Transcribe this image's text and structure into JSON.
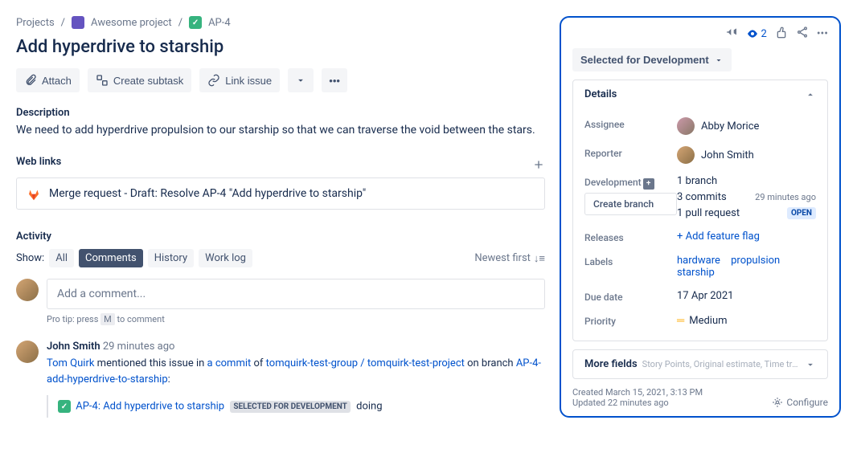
{
  "breadcrumb": {
    "projects": "Projects",
    "project_name": "Awesome project",
    "issue_key": "AP-4"
  },
  "issue": {
    "title": "Add hyperdrive to starship"
  },
  "toolbar": {
    "attach": "Attach",
    "create_subtask": "Create subtask",
    "link_issue": "Link issue"
  },
  "description": {
    "heading": "Description",
    "text": "We need to add hyperdrive propulsion to our starship so that we can traverse the void between the stars."
  },
  "weblinks": {
    "heading": "Web links",
    "item": "Merge request - Draft: Resolve AP-4 \"Add hyperdrive to starship\""
  },
  "activity": {
    "heading": "Activity",
    "show_label": "Show:",
    "tabs": {
      "all": "All",
      "comments": "Comments",
      "history": "History",
      "worklog": "Work log"
    },
    "sort": "Newest first",
    "comment_placeholder": "Add a comment...",
    "protip_pre": "Pro tip: press",
    "protip_key": "M",
    "protip_post": "to comment"
  },
  "comment": {
    "author": "John Smith",
    "time": "29 minutes ago",
    "text_user": "Tom Quirk",
    "text_mid1": " mentioned this issue in ",
    "text_commit": "a commit",
    "text_mid2": " of ",
    "text_project": "tomquirk-test-group / tomquirk-test-project",
    "text_mid3": " on branch ",
    "text_branch": "AP-4-add-hyperdrive-to-starship",
    "ref_key": "AP-4: Add hyperdrive to starship",
    "ref_status": "SELECTED FOR DEVELOPMENT",
    "ref_tail": "doing"
  },
  "sidebar": {
    "watch_count": "2",
    "status": "Selected for Development",
    "details_heading": "Details",
    "assignee_label": "Assignee",
    "assignee_value": "Abby Morice",
    "reporter_label": "Reporter",
    "reporter_value": "John Smith",
    "development_label": "Development",
    "create_branch": "Create branch",
    "dev_branch": "1 branch",
    "dev_commits": "3 commits",
    "dev_commits_ago": "29 minutes ago",
    "dev_pr": "1 pull request",
    "dev_pr_status": "OPEN",
    "releases_label": "Releases",
    "releases_action": "+  Add feature flag",
    "labels_label": "Labels",
    "labels": [
      "hardware",
      "propulsion",
      "starship"
    ],
    "due_label": "Due date",
    "due_value": "17 Apr 2021",
    "priority_label": "Priority",
    "priority_value": "Medium",
    "more_fields": "More fields",
    "more_hint": "Story Points, Original estimate, Time tracking,...",
    "created": "Created March 15, 2021, 3:13 PM",
    "updated": "Updated 22 minutes ago",
    "configure": "Configure"
  }
}
